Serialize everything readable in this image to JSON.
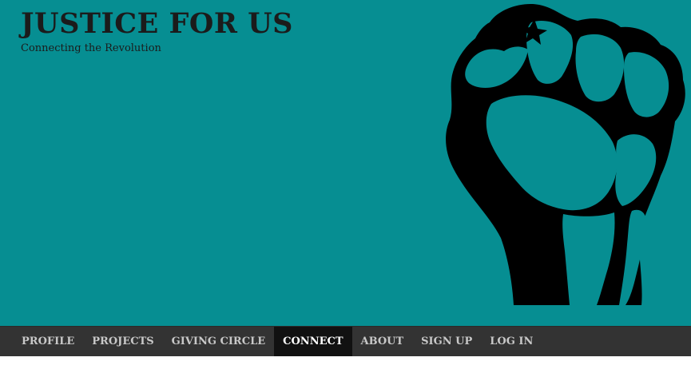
{
  "site": {
    "title": "JUSTICE FOR US",
    "tagline": "Connecting the Revolution",
    "logo_icon": "raised-fist-icon",
    "header_color": "#068e92"
  },
  "nav": {
    "items": [
      {
        "label": "PROFILE",
        "active": false
      },
      {
        "label": "PROJECTS",
        "active": false
      },
      {
        "label": "GIVING CIRCLE",
        "active": false
      },
      {
        "label": "CONNECT",
        "active": true
      },
      {
        "label": "ABOUT",
        "active": false
      },
      {
        "label": "SIGN UP",
        "active": false
      },
      {
        "label": "LOG IN",
        "active": false
      }
    ]
  }
}
